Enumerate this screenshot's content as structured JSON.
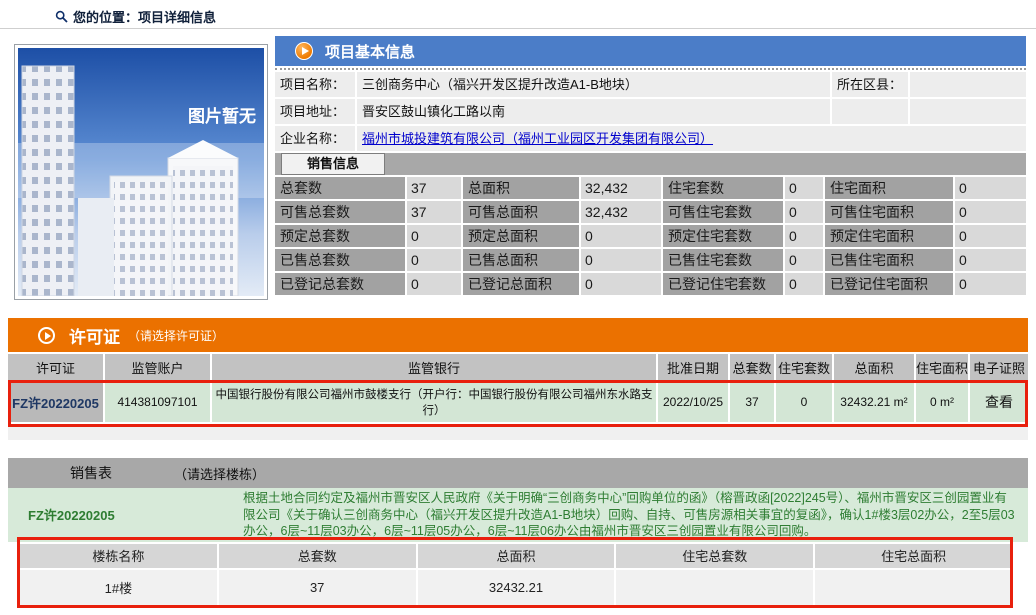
{
  "breadcrumb": {
    "label": "您的位置：项目详细信息"
  },
  "photo": {
    "placeholder_label": "图片暂无"
  },
  "basic_info": {
    "title": "项目基本信息",
    "name_label": "项目名称：",
    "name_value": "三创商务中心（福兴开发区提升改造A1-B地块）",
    "district_label": "所在区县：",
    "district_value": "",
    "address_label": "项目地址：",
    "address_value": "晋安区鼓山镇化工路以南",
    "company_label": "企业名称：",
    "company_value": "福州市城投建筑有限公司（福州工业园区开发集团有限公司）"
  },
  "sales_info": {
    "tab_label": "销售信息",
    "rows": [
      [
        {
          "label": "总套数",
          "value": "37"
        },
        {
          "label": "总面积",
          "value": "32,432"
        },
        {
          "label": "住宅套数",
          "value": "0"
        },
        {
          "label": "住宅面积",
          "value": "0"
        }
      ],
      [
        {
          "label": "可售总套数",
          "value": "37"
        },
        {
          "label": "可售总面积",
          "value": "32,432"
        },
        {
          "label": "可售住宅套数",
          "value": "0"
        },
        {
          "label": "可售住宅面积",
          "value": "0"
        }
      ],
      [
        {
          "label": "预定总套数",
          "value": "0"
        },
        {
          "label": "预定总面积",
          "value": "0"
        },
        {
          "label": "预定住宅套数",
          "value": "0"
        },
        {
          "label": "预定住宅面积",
          "value": "0"
        }
      ],
      [
        {
          "label": "已售总套数",
          "value": "0"
        },
        {
          "label": "已售总面积",
          "value": "0"
        },
        {
          "label": "已售住宅套数",
          "value": "0"
        },
        {
          "label": "已售住宅面积",
          "value": "0"
        }
      ],
      [
        {
          "label": "已登记总套数",
          "value": "0"
        },
        {
          "label": "已登记总面积",
          "value": "0"
        },
        {
          "label": "已登记住宅套数",
          "value": "0"
        },
        {
          "label": "已登记住宅面积",
          "value": "0"
        }
      ]
    ]
  },
  "permit": {
    "title": "许可证",
    "subtitle": "（请选择许可证）",
    "headers": [
      "许可证",
      "监管账户",
      "监管银行",
      "批准日期",
      "总套数",
      "住宅套数",
      "总面积",
      "住宅面积",
      "电子证照"
    ],
    "row": {
      "permit_no": "FZ许20220205",
      "account": "414381097101",
      "bank": "中国银行股份有限公司福州市鼓楼支行（开户行：中国银行股份有限公司福州东水路支行）",
      "approval_date": "2022/10/25",
      "total_units": "37",
      "residential_units": "0",
      "total_area": "32432.21 m²",
      "residential_area": "0 m²",
      "cert_link": "查看"
    }
  },
  "sales_table": {
    "title": "销售表",
    "subtitle": "（请选择楼栋）",
    "permit_no": "FZ许20220205",
    "note": "根据土地合同约定及福州市晋安区人民政府《关于明确“三创商务中心”回购单位的函》（榕晋政函[2022]245号）、福州市晋安区三创园置业有限公司《关于确认三创商务中心（福兴开发区提升改造A1-B地块）回购、自持、可售房源相关事宜的复函》，确认1#楼3层02办公，2至5层03办公，6层~11层03办公，6层~11层05办公，6层~11层06办公由福州市晋安区三创园置业有限公司回购。",
    "headers": [
      "楼栋名称",
      "总套数",
      "总面积",
      "住宅总套数",
      "住宅总面积"
    ],
    "rows": [
      [
        "1#楼",
        "37",
        "32432.21",
        "",
        ""
      ]
    ]
  },
  "colors": {
    "header_blue": "#4b7dc8",
    "header_orange": "#eb7100",
    "annotation_red": "#e8200d",
    "permit_row_green": "#d3e6d5",
    "note_green_bg": "#d7ead9",
    "green_text": "#2e7d32",
    "link_blue": "#0000cc"
  }
}
